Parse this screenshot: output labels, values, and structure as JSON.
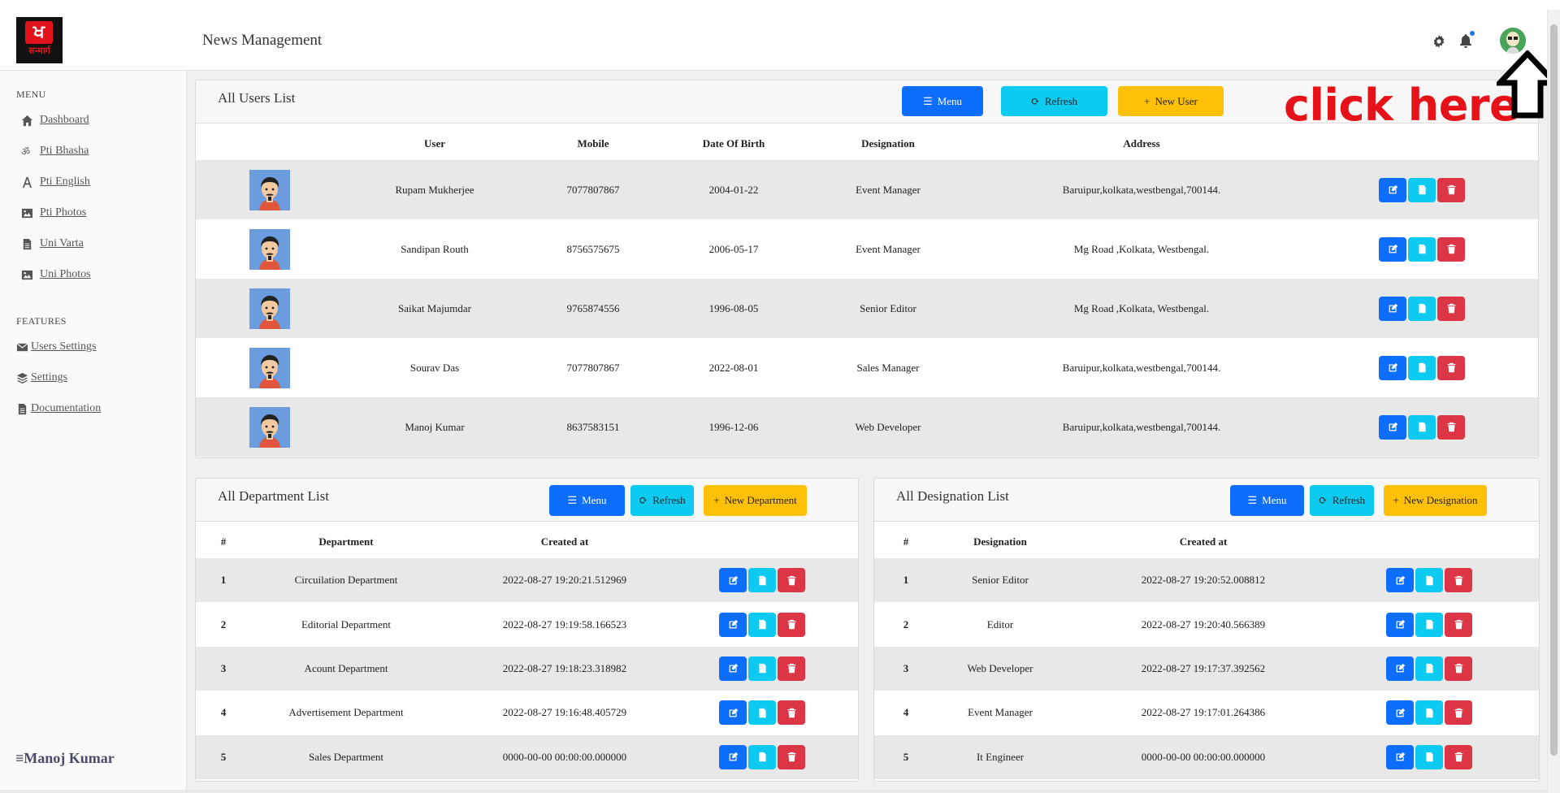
{
  "header": {
    "logo_text": "सन्मार्ग",
    "title": "News Management",
    "icons": [
      "gear-icon",
      "bell-icon",
      "user-avatar-icon"
    ]
  },
  "sidebar": {
    "menu_title": "MENU",
    "menu_items": [
      {
        "label": "Dashboard",
        "icon": "home-icon"
      },
      {
        "label": "Pti Bhasha",
        "icon": "om-icon"
      },
      {
        "label": "Pti English",
        "icon": "font-icon"
      },
      {
        "label": "Pti Photos",
        "icon": "image-icon"
      },
      {
        "label": "Uni Varta",
        "icon": "file-icon"
      },
      {
        "label": "Uni Photos",
        "icon": "image-icon"
      }
    ],
    "features_title": "FEATURES",
    "feature_items": [
      {
        "label": "Users Settings",
        "icon": "envelope-icon"
      },
      {
        "label": "Settings",
        "icon": "layers-icon"
      },
      {
        "label": "Documentation",
        "icon": "file-icon"
      }
    ],
    "user_name": "≡Manoj Kumar"
  },
  "users_card": {
    "title": "All Users List",
    "menu_label": "Menu",
    "refresh_label": "Refresh",
    "new_label": "New User",
    "columns": [
      "User",
      "Mobile",
      "Date Of Birth",
      "Designation",
      "Address"
    ],
    "rows": [
      {
        "user": "Rupam Mukherjee",
        "mobile": "7077807867",
        "dob": "2004-01-22",
        "designation": "Event Manager",
        "address": "Baruipur,kolkata,westbengal,700144."
      },
      {
        "user": "Sandipan Routh",
        "mobile": "8756575675",
        "dob": "2006-05-17",
        "designation": "Event Manager",
        "address": "Mg Road ,Kolkata, Westbengal."
      },
      {
        "user": "Saikat Majumdar",
        "mobile": "9765874556",
        "dob": "1996-08-05",
        "designation": "Senior Editor",
        "address": "Mg Road ,Kolkata, Westbengal."
      },
      {
        "user": "Sourav Das",
        "mobile": "7077807867",
        "dob": "2022-08-01",
        "designation": "Sales Manager",
        "address": "Baruipur,kolkata,westbengal,700144."
      },
      {
        "user": "Manoj Kumar",
        "mobile": "8637583151",
        "dob": "1996-12-06",
        "designation": "Web Developer",
        "address": "Baruipur,kolkata,westbengal,700144."
      }
    ]
  },
  "dept_card": {
    "title": "All Department List",
    "menu_label": "Menu",
    "refresh_label": "Refresh",
    "new_label": "New Department",
    "columns": [
      "#",
      "Department",
      "Created at"
    ],
    "rows": [
      {
        "num": "1",
        "name": "Circuilation Department",
        "created": "2022-08-27 19:20:21.512969"
      },
      {
        "num": "2",
        "name": "Editorial Department",
        "created": "2022-08-27 19:19:58.166523"
      },
      {
        "num": "3",
        "name": "Acount Department",
        "created": "2022-08-27 19:18:23.318982"
      },
      {
        "num": "4",
        "name": "Advertisement Department",
        "created": "2022-08-27 19:16:48.405729"
      },
      {
        "num": "5",
        "name": "Sales Department",
        "created": "0000-00-00 00:00:00.000000"
      }
    ]
  },
  "desig_card": {
    "title": "All Designation List",
    "menu_label": "Menu",
    "refresh_label": "Refresh",
    "new_label": "New Designation",
    "columns": [
      "#",
      "Designation",
      "Created at"
    ],
    "rows": [
      {
        "num": "1",
        "name": "Senior Editor",
        "created": "2022-08-27 19:20:52.008812"
      },
      {
        "num": "2",
        "name": "Editor",
        "created": "2022-08-27 19:20:40.566389"
      },
      {
        "num": "3",
        "name": "Web Developer",
        "created": "2022-08-27 19:17:37.392562"
      },
      {
        "num": "4",
        "name": "Event Manager",
        "created": "2022-08-27 19:17:01.264386"
      },
      {
        "num": "5",
        "name": "It Engineer",
        "created": "0000-00-00 00:00:00.000000"
      }
    ]
  },
  "annotation": {
    "text": "click here",
    "color": "#e5121a"
  },
  "colors": {
    "primary": "#0d6efd",
    "info": "#0dcaf0",
    "warning": "#ffc107",
    "danger": "#dc3545"
  }
}
